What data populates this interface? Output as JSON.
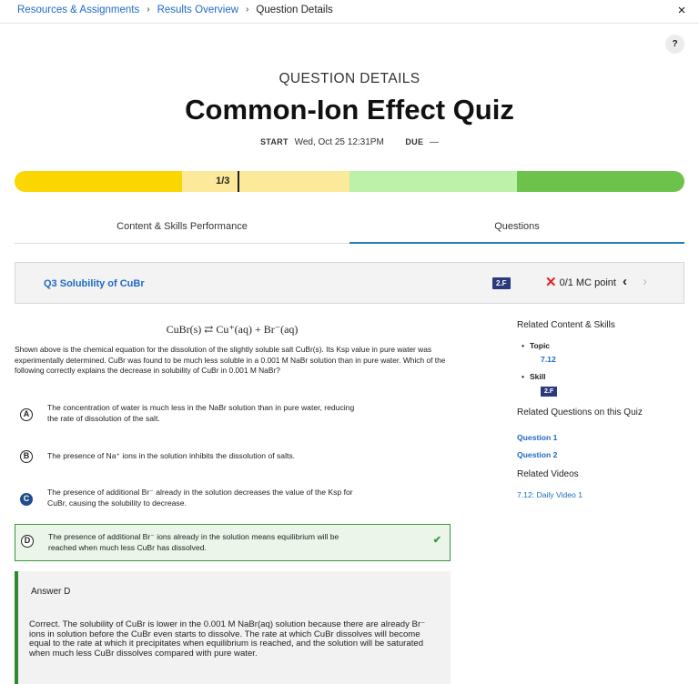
{
  "breadcrumb": {
    "items": [
      "Resources & Assignments",
      "Results Overview"
    ],
    "current": "Question Details"
  },
  "icons": {
    "close": "×",
    "help": "?",
    "separator": "›",
    "wrong": "✕",
    "check": "✔",
    "prev": "‹",
    "next": "›"
  },
  "header": {
    "eyebrow": "QUESTION DETAILS",
    "title": "Common-Ion Effect Quiz",
    "start_label": "START",
    "start_value": "Wed, Oct 25 12:31PM",
    "due_label": "DUE",
    "due_value": "—"
  },
  "progress": {
    "label": "1/3",
    "fraction": 0.333,
    "colors": [
      "#fbd600",
      "#fde99a",
      "#bdf0a8",
      "#6cc24a"
    ]
  },
  "tabs": [
    {
      "label": "Content & Skills Performance"
    },
    {
      "label": "Questions"
    }
  ],
  "question": {
    "title": "Q3 Solubility of CuBr",
    "skill": "2.F",
    "score": "0/1 MC point",
    "equation": "CuBr(s) ⇄ Cu⁺(aq) + Br⁻(aq)",
    "prompt": "Shown above is the chemical equation for the dissolution of the slightly soluble salt CuBr(s). Its Ksp value in pure water was experimentally determined. CuBr was found to be much less soluble in a 0.001 M NaBr solution than in pure water. Which of the following correctly explains the decrease in solubility of CuBr in 0.001 M NaBr?",
    "choices": [
      {
        "letter": "A",
        "line1": "The concentration of water is much less in the NaBr solution than in pure water, reducing",
        "line2": "the rate of dissolution of the salt."
      },
      {
        "letter": "B",
        "line1": "The presence of Na⁺ ions in the solution inhibits the dissolution of salts.",
        "line2": ""
      },
      {
        "letter": "C",
        "line1": "The presence of additional Br⁻ already in the solution decreases the value of the Ksp for",
        "line2": "CuBr, causing the solubility to decrease."
      },
      {
        "letter": "D",
        "line1": "The presence of additional Br⁻ ions already in the solution means equilibrium will be",
        "line2": "reached when much less CuBr has dissolved."
      }
    ]
  },
  "answer": {
    "title": "Answer D",
    "text": "Correct. The solubility of CuBr is lower in the 0.001 M NaBr(aq) solution because there are already Br⁻ ions in solution before the CuBr even starts to dissolve. The rate at which CuBr dissolves will become equal to the rate at which it precipitates when equilibrium is reached, and the solution will be saturated when much less CuBr dissolves compared with pure water."
  },
  "sidebar": {
    "related_heading": "Related Content & Skills",
    "topic_label": "Topic",
    "topic_value": "7.12",
    "skill_label": "Skill",
    "skill_value": "2.F",
    "questions_heading": "Related Questions on this Quiz",
    "questions": [
      "Question 1",
      "Question 2"
    ],
    "videos_heading": "Related Videos",
    "videos": [
      "7.12: Daily Video 1"
    ]
  }
}
